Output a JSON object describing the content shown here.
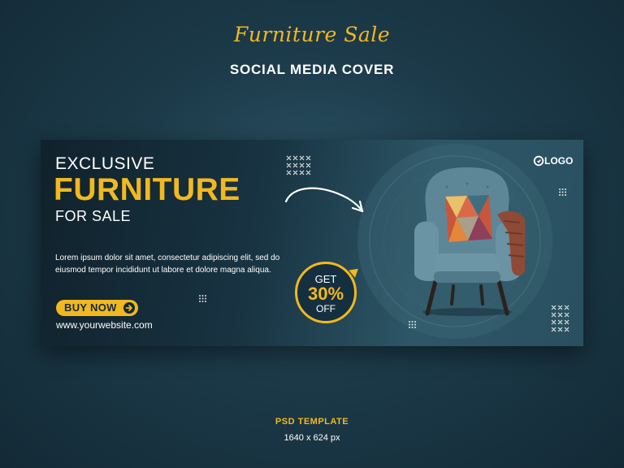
{
  "header": {
    "title": "Furniture Sale",
    "subtitle": "SOCIAL MEDIA COVER"
  },
  "banner": {
    "headline_line1": "EXCLUSIVE",
    "headline_line2": "FURNITURE",
    "headline_line3": "FOR SALE",
    "body_text": "Lorem ipsum dolor sit amet, consectetur adipiscing elit, sed do eiusmod tempor incididunt ut labore et dolore magna aliqua.",
    "cta_label": "BUY NOW",
    "website": "www.yourwebsite.com",
    "logo_text": "LOGO",
    "discount": {
      "prefix": "GET",
      "value": "30%",
      "suffix": "OFF"
    }
  },
  "footer": {
    "template_label": "PSD TEMPLATE",
    "dimensions": "1640 x 624 px"
  },
  "colors": {
    "accent": "#f2b81f",
    "background": "#1c3a49",
    "banner_dark": "#10222c",
    "chair": "#5d8797"
  },
  "icons": [
    "curved-arrow-icon",
    "right-arrow-icon",
    "logo-icon",
    "dot-grid-icon",
    "cross-pattern-icon",
    "armchair-image"
  ]
}
